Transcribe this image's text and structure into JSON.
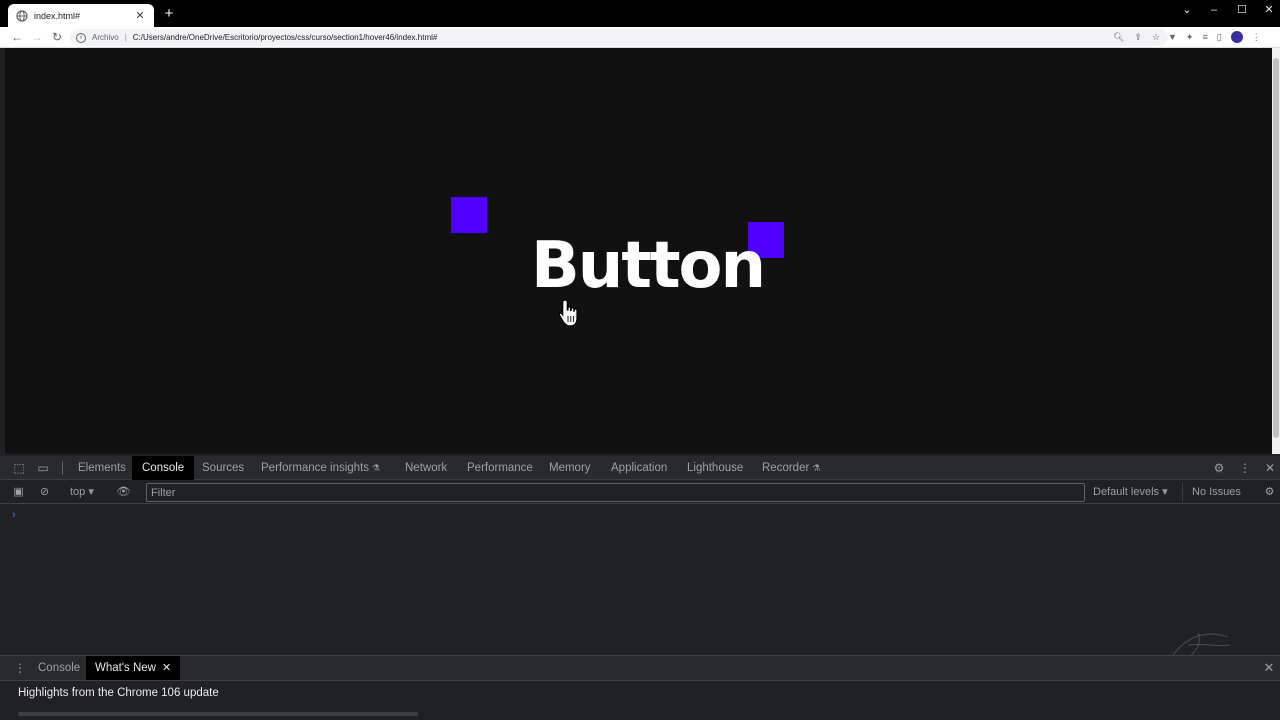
{
  "browser": {
    "tab_title": "index.html#",
    "address_prefix": "Archivo",
    "address_separator": "|",
    "url": "C:/Users/andre/OneDrive/Escritorio/proyectos/css/curso/section1/hover46/index.html#"
  },
  "page": {
    "button_text": "Button",
    "background_color": "#111111",
    "text_color": "#ffffff",
    "accent_color": "#4f00ff"
  },
  "devtools": {
    "tabs": [
      "Elements",
      "Console",
      "Sources",
      "Performance insights",
      "Network",
      "Performance",
      "Memory",
      "Application",
      "Lighthouse",
      "Recorder"
    ],
    "active_tab": "Console",
    "console": {
      "context": "top",
      "filter_placeholder": "Filter",
      "levels": "Default levels",
      "issues": "No Issues"
    },
    "drawer": {
      "tabs": [
        "Console",
        "What's New"
      ],
      "active_tab": "What's New",
      "highlights": "Highlights from the Chrome 106 update"
    }
  }
}
